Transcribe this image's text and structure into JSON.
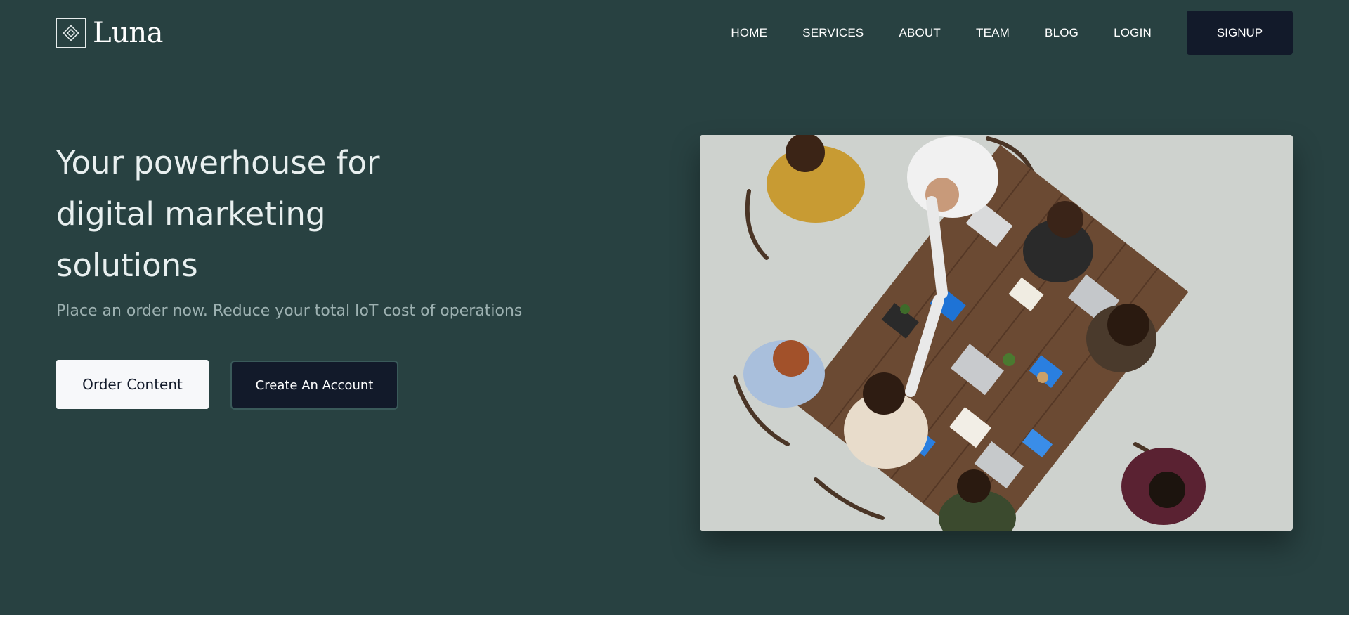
{
  "brand": {
    "name": "Luna",
    "logo_icon": "diamond-logo-icon"
  },
  "nav": {
    "items": [
      {
        "label": "HOME"
      },
      {
        "label": "SERVICES"
      },
      {
        "label": "ABOUT"
      },
      {
        "label": "TEAM"
      },
      {
        "label": "BLOG"
      },
      {
        "label": "LOGIN"
      }
    ],
    "signup_label": "SIGNUP"
  },
  "hero": {
    "title": "Your powerhouse for digital marketing solutions",
    "subtitle": "Place an order now. Reduce your total IoT cost of operations",
    "primary_button": "Order Content",
    "secondary_button": "Create An Account",
    "image_subject": "team meeting around table viewed from above"
  },
  "colors": {
    "background": "#284141",
    "dark_button": "#121a2a",
    "light_button": "#f7f8fa",
    "subtitle": "#9db1b1"
  }
}
